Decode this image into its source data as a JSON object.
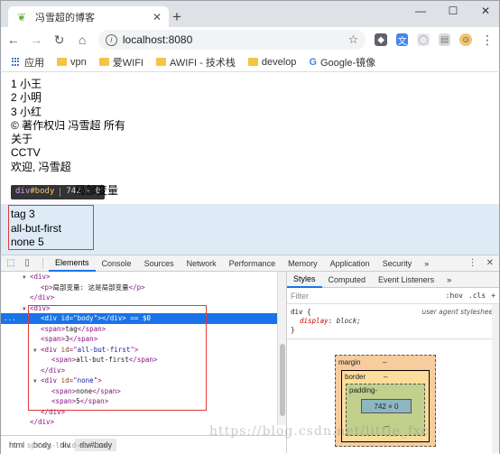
{
  "browser": {
    "tab_title": "冯雪超的博客",
    "tab_close": "✕",
    "new_tab": "+",
    "url": "localhost:8080",
    "window_buttons": [
      "—",
      "☐",
      "✕"
    ]
  },
  "bookmarks": [
    {
      "label": "应用",
      "icon": "apps-icon"
    },
    {
      "label": "vpn",
      "icon": "folder-icon"
    },
    {
      "label": "爱WIFI",
      "icon": "folder-icon"
    },
    {
      "label": "AWIFI - 技术栈",
      "icon": "folder-icon"
    },
    {
      "label": "develop",
      "icon": "folder-icon"
    },
    {
      "label": "Google-镜像",
      "icon": "google-icon"
    }
  ],
  "page": {
    "lines": [
      "1 小王",
      "2 小明",
      "3 小红",
      "© 著作权归 冯雪超 所有",
      "关于",
      "CCTV",
      "欢迎, 冯雪超"
    ],
    "local_var": "局部变量",
    "highlighted_lines": [
      "tag 3",
      "all-but-first",
      "none 5"
    ],
    "tooltip_tag": "div",
    "tooltip_id": "#body",
    "tooltip_size": "742 × 0"
  },
  "devtools": {
    "tabs": [
      "Elements",
      "Console",
      "Sources",
      "Network",
      "Performance",
      "Memory",
      "Application",
      "Security",
      "»"
    ],
    "active_tab": "Elements",
    "elements": {
      "lines": [
        {
          "indent": 2,
          "tri": "▼",
          "html": [
            [
              "tag",
              "<div>"
            ]
          ]
        },
        {
          "indent": 3,
          "tri": "",
          "html": [
            [
              "tag",
              "<p>"
            ],
            [
              "text",
              "局部变量: 这是局部变量"
            ],
            [
              "tag",
              "</p>"
            ]
          ]
        },
        {
          "indent": 2,
          "tri": "",
          "html": [
            [
              "tag",
              "</div>"
            ]
          ]
        },
        {
          "indent": 2,
          "tri": "▼",
          "html": [
            [
              "tag",
              "<div>"
            ]
          ]
        },
        {
          "indent": 3,
          "tri": "",
          "selected": true,
          "html": [
            [
              "tag",
              "<div "
            ],
            [
              "attr",
              "id"
            ],
            [
              "tag",
              "=\""
            ],
            [
              "val",
              "body"
            ],
            [
              "tag",
              "\"></div>"
            ],
            [
              "text",
              " == $0"
            ]
          ]
        },
        {
          "indent": 3,
          "tri": "",
          "html": [
            [
              "tag",
              "<span>"
            ],
            [
              "text",
              "tag"
            ],
            [
              "tag",
              "</span>"
            ]
          ]
        },
        {
          "indent": 3,
          "tri": "",
          "html": [
            [
              "tag",
              "<span>"
            ],
            [
              "text",
              "3"
            ],
            [
              "tag",
              "</span>"
            ]
          ]
        },
        {
          "indent": 3,
          "tri": "▼",
          "html": [
            [
              "tag",
              "<div "
            ],
            [
              "attr",
              "id"
            ],
            [
              "tag",
              "=\""
            ],
            [
              "val",
              "all-but-first"
            ],
            [
              "tag",
              "\">"
            ]
          ]
        },
        {
          "indent": 4,
          "tri": "",
          "html": [
            [
              "tag",
              "<span>"
            ],
            [
              "text",
              "all-but-first"
            ],
            [
              "tag",
              "</span>"
            ]
          ]
        },
        {
          "indent": 3,
          "tri": "",
          "html": [
            [
              "tag",
              "</div>"
            ]
          ]
        },
        {
          "indent": 3,
          "tri": "▼",
          "html": [
            [
              "tag",
              "<div "
            ],
            [
              "attr",
              "id"
            ],
            [
              "tag",
              "=\""
            ],
            [
              "val",
              "none"
            ],
            [
              "tag",
              "\">"
            ]
          ]
        },
        {
          "indent": 4,
          "tri": "",
          "html": [
            [
              "tag",
              "<span>"
            ],
            [
              "text",
              "none"
            ],
            [
              "tag",
              "</span>"
            ]
          ]
        },
        {
          "indent": 4,
          "tri": "",
          "html": [
            [
              "tag",
              "<span>"
            ],
            [
              "text",
              "5"
            ],
            [
              "tag",
              "</span>"
            ]
          ]
        },
        {
          "indent": 3,
          "tri": "",
          "html": [
            [
              "tag",
              "</div>"
            ]
          ]
        },
        {
          "indent": 2,
          "tri": "",
          "html": [
            [
              "tag",
              "</div>"
            ]
          ]
        },
        {
          "indent": 1,
          "tri": "",
          "html": [
            [
              "tag",
              "</body>"
            ]
          ]
        }
      ],
      "selected_marker": "..."
    },
    "breadcrumbs": [
      "html",
      "body",
      "div",
      "div#body"
    ],
    "styles_tabs": [
      "Styles",
      "Computed",
      "Event Listeners",
      "»"
    ],
    "filter_placeholder": "Filter",
    "filter_tools": [
      ":hov",
      ".cls",
      "+"
    ],
    "rule": {
      "selector": "div {",
      "source": "user agent stylesheet",
      "property": "display",
      "value": "block;",
      "close": "}"
    },
    "box_model": {
      "margin": "margin",
      "margin_value": "–",
      "border": "border",
      "border_value": "–",
      "padding": "padding-",
      "content": "742 × 0",
      "side_dash": "–"
    }
  },
  "watermark": "https://blog.csdn.net/little_fxc",
  "faded_text": "spring-lucid-service"
}
